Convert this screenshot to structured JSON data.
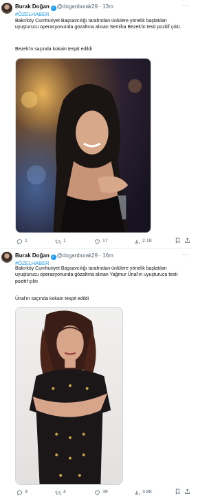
{
  "tweets": [
    {
      "author": "Burak Doğan",
      "handle": "@doganburak29",
      "time": "13m",
      "hashtag": "#ÖZELHABER",
      "text": "Bakırköy Cumhuriyet Başsavcılığı tarafından ünlülere yönelik başlatılan uyuşturucu operasyonunda gözaltına alınan Semiha Bezek'in testi pozitif çıktı.",
      "text2": "Bezek'in saçında kokain tespit edildi",
      "replies": "1",
      "retweets": "1",
      "likes": "17",
      "views": "2.1K"
    },
    {
      "author": "Burak Doğan",
      "handle": "@doganburak29",
      "time": "16m",
      "hashtag": "#ÖZELHABER",
      "text": "Bakırköy Cumhuriyet Başsavcılığı tarafından ünlülere yönelik başlatılan uyuşturucu operasyonunda gözaltına alınan Yağmur Ünal'ın uyuşturucu testi pozitif çıktı",
      "text2": "Ünal'ın saçında kokain tespit edildi",
      "replies": "3",
      "retweets": "4",
      "likes": "39",
      "views": "3.8K"
    }
  ],
  "icons": {
    "verified": "verified-badge-icon",
    "more": "more-options-icon",
    "reply": "reply-icon",
    "retweet": "retweet-icon",
    "like": "heart-icon",
    "views": "views-bar-chart-icon",
    "bookmark": "bookmark-icon",
    "share": "share-icon"
  },
  "colors": {
    "accent": "#1d9bf0",
    "text": "#0f1419",
    "muted": "#536471",
    "border": "#eff3f4"
  }
}
